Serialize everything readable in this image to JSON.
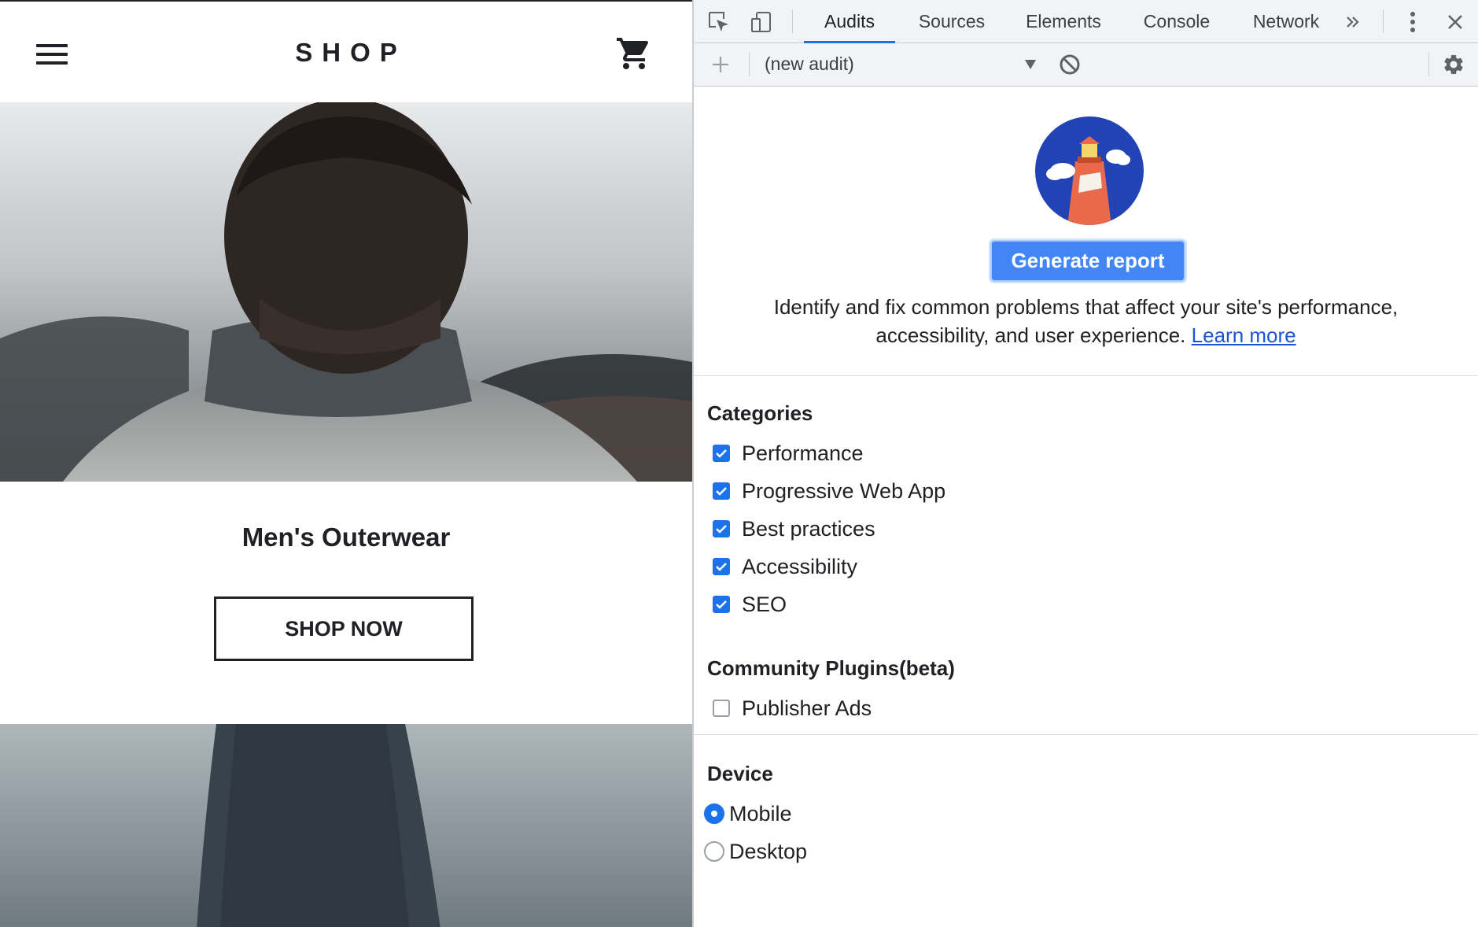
{
  "shop": {
    "title": "SHOP",
    "product_name": "Men's Outerwear",
    "shop_now_label": "SHOP NOW"
  },
  "devtools": {
    "tabs": [
      {
        "label": "Audits",
        "active": true
      },
      {
        "label": "Sources",
        "active": false
      },
      {
        "label": "Elements",
        "active": false
      },
      {
        "label": "Console",
        "active": false
      },
      {
        "label": "Network",
        "active": false
      }
    ],
    "audit_select": "(new audit)",
    "generate_label": "Generate report",
    "description": "Identify and fix common problems that affect your site's performance, accessibility, and user experience.",
    "learn_more": "Learn more",
    "categories_title": "Categories",
    "categories": [
      {
        "label": "Performance",
        "checked": true
      },
      {
        "label": "Progressive Web App",
        "checked": true
      },
      {
        "label": "Best practices",
        "checked": true
      },
      {
        "label": "Accessibility",
        "checked": true
      },
      {
        "label": "SEO",
        "checked": true
      }
    ],
    "plugins_title": "Community Plugins(beta)",
    "plugins": [
      {
        "label": "Publisher Ads",
        "checked": false
      }
    ],
    "device_title": "Device",
    "devices": [
      {
        "label": "Mobile",
        "selected": true
      },
      {
        "label": "Desktop",
        "selected": false
      }
    ]
  },
  "colors": {
    "accent": "#1a73e8",
    "button": "#4285f4",
    "link": "#1a55d6",
    "text": "#202124"
  }
}
